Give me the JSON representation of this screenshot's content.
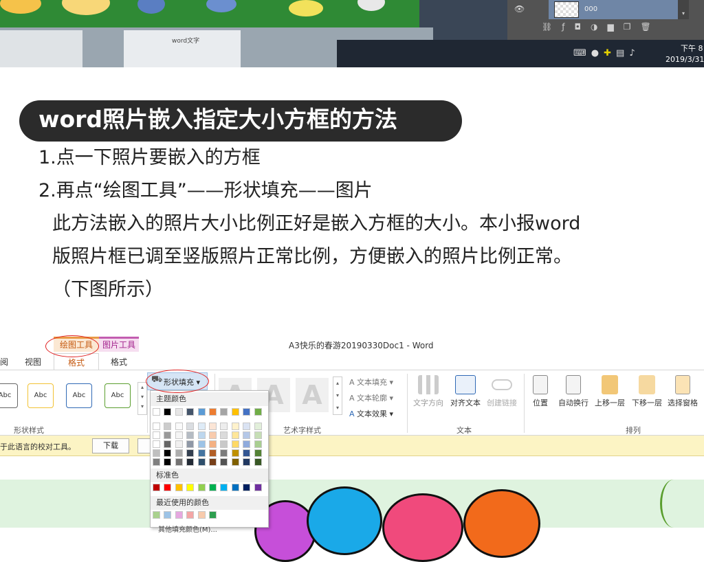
{
  "desktop": {
    "ps_layer_name": "000",
    "tray_time": "下午 8",
    "tray_date": "2019/3/31",
    "mini_doc_text": "word文字"
  },
  "tutorial": {
    "title": "word照片嵌入指定大小方框的方法",
    "step1": "1.点一下照片要嵌入的方框",
    "step2": "2.再点“绘图工具”——形状填充——图片",
    "desc_line1": "此方法嵌入的照片大小比例正好是嵌入方框的大小。本小报word",
    "desc_line2": "版照片框已调至竖版照片正常比例，方便嵌入的照片比例正常。",
    "desc_line3": "（下图所示）"
  },
  "word": {
    "window_title": "A3快乐的春游20190330Doc1 - Word",
    "context_tab_drawing": "绘图工具",
    "context_tab_picture": "图片工具",
    "tab_view_partial": "阅",
    "tab_view": "视图",
    "tab_format_drawing": "格式",
    "tab_format_picture": "格式",
    "shape_styles": [
      "Abc",
      "Abc",
      "Abc",
      "Abc"
    ],
    "shape_fill_label": "形状填充",
    "wordart_samples": [
      "A",
      "A",
      "A"
    ],
    "text_fill": "文本填充",
    "text_outline": "文本轮廓",
    "text_effects": "文本效果",
    "text_direction": "文字方向",
    "align_text": "对齐文本",
    "create_link": "创建链接",
    "position": "位置",
    "wrap_text": "自动换行",
    "bring_forward": "上移一层",
    "send_backward": "下移一层",
    "selection_pane": "选择窗格",
    "group_shape_styles": "形状样式",
    "group_wordart_styles": "艺术字样式",
    "group_text": "文本",
    "group_arrange": "排列",
    "notice_text": "于此语言的校对工具。",
    "notice_download": "下载"
  },
  "fill_dropdown": {
    "theme_colors_label": "主题颜色",
    "standard_colors_label": "标准色",
    "recent_colors_label": "最近使用的颜色",
    "more_colors_label": "其他填充颜色(M)...",
    "theme_top_row": [
      "#ffffff",
      "#000000",
      "#e7e6e6",
      "#44546a",
      "#5b9bd5",
      "#ed7d31",
      "#a5a5a5",
      "#ffc000",
      "#4472c4",
      "#70ad47"
    ],
    "standard_colors": [
      "#c00000",
      "#ff0000",
      "#ffc000",
      "#ffff00",
      "#92d050",
      "#00b050",
      "#00b0f0",
      "#0070c0",
      "#002060",
      "#7030a0"
    ],
    "recent_colors": [
      "#a9d18e",
      "#9dc3e6",
      "#e6a8e0",
      "#f4a6a6",
      "#f8cbad",
      "#2e9e4f"
    ]
  },
  "colors": {
    "title_pill": "#2b2b2b",
    "drawing_tools_accent": "#c55a11",
    "picture_tools_accent": "#a3238d",
    "annotation_red": "#e02020"
  }
}
